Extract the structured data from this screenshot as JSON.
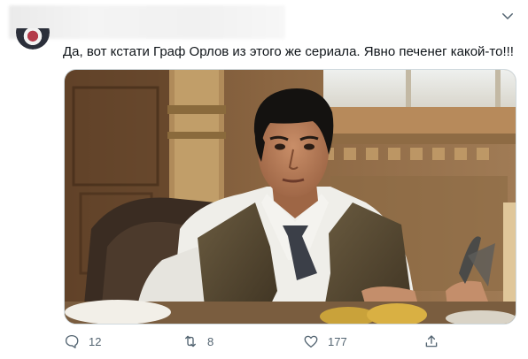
{
  "tweet": {
    "text": "Да, вот кстати Граф Орлов из этого же сериала. Явно печенег какой-то!!!"
  },
  "media": {
    "type": "photo",
    "alt": ""
  },
  "actions": {
    "reply_count": "12",
    "retweet_count": "8",
    "like_count": "177"
  },
  "icons": {
    "reply": "speech-bubble-icon",
    "retweet": "retweet-icon",
    "like": "heart-icon",
    "share": "share-icon",
    "more": "chevron-down-icon"
  },
  "colors": {
    "text": "#0f1419",
    "secondary": "#536471",
    "border": "#cfd9de"
  }
}
